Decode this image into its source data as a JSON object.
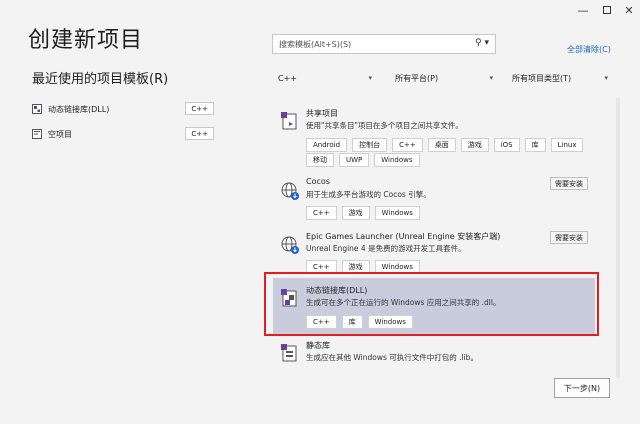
{
  "window": {
    "minimize_icon": "—",
    "close_icon": "✕"
  },
  "page": {
    "title": "创建新项目"
  },
  "recent": {
    "title": "最近使用的项目模板(R)",
    "items": [
      {
        "label": "动态链接库(DLL)",
        "lang": "C++"
      },
      {
        "label": "空项目",
        "lang": "C++"
      }
    ]
  },
  "search": {
    "placeholder": "搜索模板(Alt+S)(S)",
    "icon": "search-icon"
  },
  "clear_all": "全部清除(C)",
  "filters": {
    "language": "C++",
    "platform": "所有平台(P)",
    "project_type": "所有项目类型(T)"
  },
  "templates": [
    {
      "name": "共享项目",
      "desc": "使用\"共享条目\"项目在多个项目之间共享文件。",
      "tags_row1": [
        "Android",
        "控制台",
        "C++",
        "桌面",
        "游戏",
        "iOS",
        "库",
        "Linux"
      ],
      "tags_row2": [
        "移动",
        "UWP",
        "Windows"
      ]
    },
    {
      "name": "Cocos",
      "desc": "用于生成多平台游戏的 Cocos 引擎。",
      "install": "需要安装",
      "tags": [
        "C++",
        "游戏",
        "Windows"
      ]
    },
    {
      "name": "Epic Games Launcher (Unreal Engine 安装客户端)",
      "desc": "Unreal Engine 4 是免费的游戏开发工具套件。",
      "install": "需要安装",
      "tags": [
        "C++",
        "游戏",
        "Windows"
      ]
    },
    {
      "name": "动态链接库(DLL)",
      "desc": "生成可在多个正在运行的 Windows 应用之间共享的 .dll。",
      "tags": [
        "C++",
        "库",
        "Windows"
      ]
    },
    {
      "name": "静态库",
      "desc": "生成应在其他 Windows 可执行文件中打包的 .lib。"
    }
  ],
  "next_button": "下一步(N)",
  "colors": {
    "selection": "#c9ccdc",
    "highlight_border": "#e02020",
    "link": "#1e64c8"
  }
}
